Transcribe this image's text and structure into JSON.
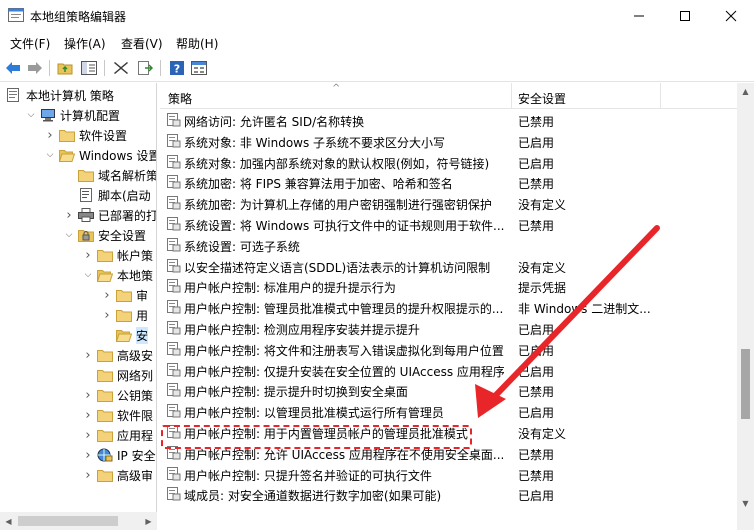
{
  "window": {
    "title": "本地组策略编辑器"
  },
  "menu": [
    "文件(F)",
    "操作(A)",
    "查看(V)",
    "帮助(H)"
  ],
  "tree": [
    {
      "label": "本地计算机 策略",
      "level": 0,
      "expander": "",
      "icon": "computer-policy"
    },
    {
      "label": "计算机配置",
      "level": 1,
      "expander": "down",
      "icon": "computer"
    },
    {
      "label": "软件设置",
      "level": 2,
      "expander": "right",
      "icon": "folder"
    },
    {
      "label": "Windows 设置",
      "level": 2,
      "expander": "down",
      "icon": "folder-open"
    },
    {
      "label": "域名解析策",
      "level": 3,
      "expander": "",
      "icon": "folder"
    },
    {
      "label": "脚本(启动",
      "level": 3,
      "expander": "",
      "icon": "script"
    },
    {
      "label": "已部署的打",
      "level": 3,
      "expander": "right",
      "icon": "printer"
    },
    {
      "label": "安全设置",
      "level": 3,
      "expander": "down",
      "icon": "security"
    },
    {
      "label": "帐户策",
      "level": 4,
      "expander": "right",
      "icon": "folder"
    },
    {
      "label": "本地策",
      "level": 4,
      "expander": "down",
      "icon": "folder-open"
    },
    {
      "label": "审",
      "level": 5,
      "expander": "right",
      "icon": "folder"
    },
    {
      "label": "用",
      "level": 5,
      "expander": "right",
      "icon": "folder"
    },
    {
      "label": "安",
      "level": 5,
      "expander": "",
      "icon": "folder-open",
      "selected": true
    },
    {
      "label": "高级安",
      "level": 4,
      "expander": "right",
      "icon": "folder"
    },
    {
      "label": "网络列",
      "level": 4,
      "expander": "",
      "icon": "folder"
    },
    {
      "label": "公钥策",
      "level": 4,
      "expander": "right",
      "icon": "folder"
    },
    {
      "label": "软件限",
      "level": 4,
      "expander": "right",
      "icon": "folder"
    },
    {
      "label": "应用程",
      "level": 4,
      "expander": "right",
      "icon": "folder"
    },
    {
      "label": "IP 安全",
      "level": 4,
      "expander": "right",
      "icon": "ipsec"
    },
    {
      "label": "高级审",
      "level": 4,
      "expander": "right",
      "icon": "folder"
    }
  ],
  "columns": {
    "policy": "策略",
    "setting": "安全设置"
  },
  "rows": [
    {
      "policy": "网络访问: 允许匿名 SID/名称转换",
      "setting": "已禁用"
    },
    {
      "policy": "系统对象: 非 Windows 子系统不要求区分大小写",
      "setting": "已启用"
    },
    {
      "policy": "系统对象: 加强内部系统对象的默认权限(例如，符号链接)",
      "setting": "已启用"
    },
    {
      "policy": "系统加密: 将 FIPS 兼容算法用于加密、哈希和签名",
      "setting": "已禁用"
    },
    {
      "policy": "系统加密: 为计算机上存储的用户密钥强制进行强密钥保护",
      "setting": "没有定义"
    },
    {
      "policy": "系统设置: 将 Windows 可执行文件中的证书规则用于软件...",
      "setting": "已禁用"
    },
    {
      "policy": "系统设置: 可选子系统",
      "setting": ""
    },
    {
      "policy": "以安全描述符定义语言(SDDL)语法表示的计算机访问限制",
      "setting": "没有定义"
    },
    {
      "policy": "用户帐户控制: 标准用户的提升提示行为",
      "setting": "提示凭据"
    },
    {
      "policy": "用户帐户控制: 管理员批准模式中管理员的提升权限提示的...",
      "setting": "非 Windows 二进制文..."
    },
    {
      "policy": "用户帐户控制: 检测应用程序安装并提示提升",
      "setting": "已启用"
    },
    {
      "policy": "用户帐户控制: 将文件和注册表写入错误虚拟化到每用户位置",
      "setting": "已启用"
    },
    {
      "policy": "用户帐户控制: 仅提升安装在安全位置的 UIAccess 应用程序",
      "setting": "已启用"
    },
    {
      "policy": "用户帐户控制: 提示提升时切换到安全桌面",
      "setting": "已禁用"
    },
    {
      "policy": "用户帐户控制: 以管理员批准模式运行所有管理员",
      "setting": "已启用"
    },
    {
      "policy": "用户帐户控制: 用于内置管理员帐户的管理员批准模式",
      "setting": "没有定义"
    },
    {
      "policy": "用户帐户控制: 允许 UIAccess 应用程序在不使用安全桌面...",
      "setting": "已禁用"
    },
    {
      "policy": "用户帐户控制: 只提升签名并验证的可执行文件",
      "setting": "已禁用"
    },
    {
      "policy": "域成员: 对安全通道数据进行数字加密(如果可能)",
      "setting": "已启用"
    }
  ],
  "colors": {
    "annotation": "#e8262a",
    "selection": "#cde8ff"
  }
}
